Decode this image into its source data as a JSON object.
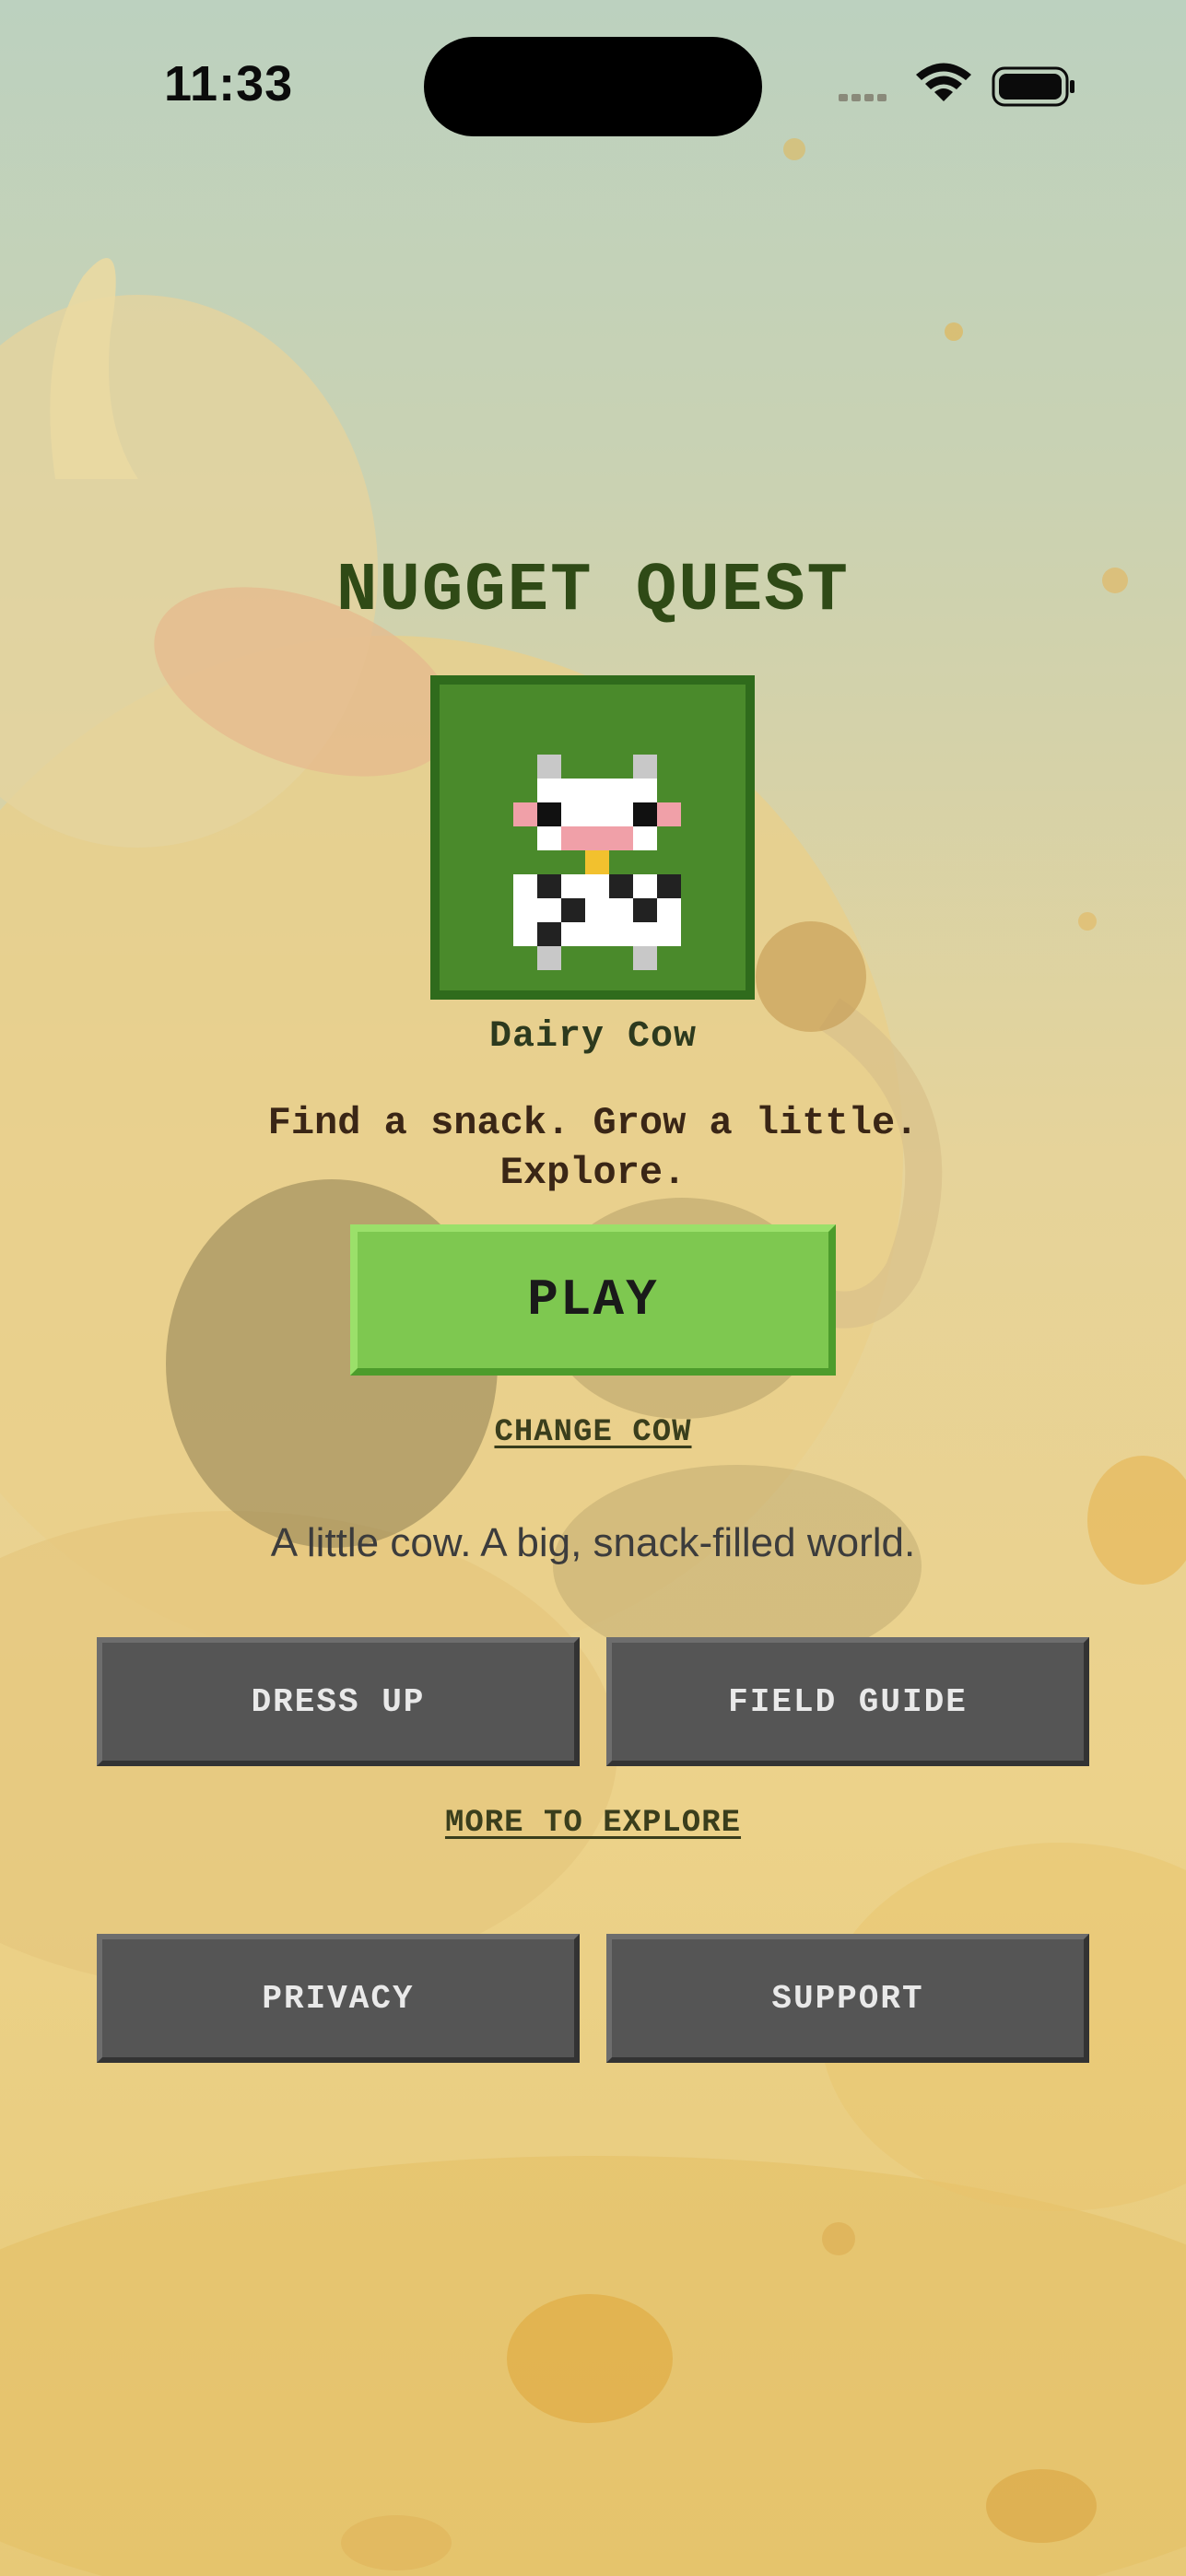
{
  "status_bar": {
    "time": "11:33",
    "icons": [
      "signal-icon",
      "wifi-icon",
      "battery-icon"
    ]
  },
  "game": {
    "title": "NUGGET QUEST",
    "cow_name": "Dairy Cow",
    "tagline": "Find a snack. Grow a little. Explore.",
    "play_label": "PLAY",
    "change_cow_label": "CHANGE COW",
    "subtitle": "A little cow. A big, snack-filled world.",
    "dress_up_label": "DRESS UP",
    "field_guide_label": "FIELD GUIDE",
    "more_to_explore_label": "MORE TO EXPLORE",
    "privacy_label": "PRIVACY",
    "support_label": "SUPPORT"
  },
  "colors": {
    "title": "#2f4a16",
    "portrait_bg": "#4a8a2b",
    "play_button": "#7ec850",
    "gray_button": "#555555"
  }
}
